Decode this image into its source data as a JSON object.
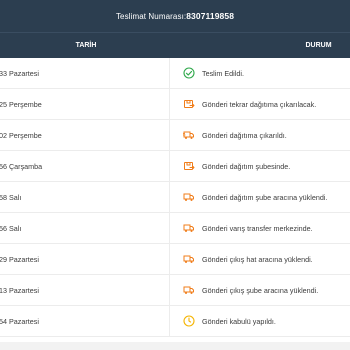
{
  "tracking": {
    "label": "Teslimat Numarası:",
    "number": "8307119858"
  },
  "table": {
    "headers": {
      "date": "TARİH",
      "status": "DURUM"
    },
    "rows": [
      {
        "date": ":33 Pazartesi",
        "status": "Teslim Edildi.",
        "icon": "check-circle-icon",
        "color": "#2ea84a"
      },
      {
        "date": ":25 Perşembe",
        "status": "Gönderi tekrar dağıtıma çıkarılacak.",
        "icon": "box-return-icon",
        "color": "#f07d1a"
      },
      {
        "date": ":02 Perşembe",
        "status": "Gönderi dağıtıma çıkarıldı.",
        "icon": "delivery-truck-icon",
        "color": "#f07d1a"
      },
      {
        "date": ":56 Çarşamba",
        "status": "Gönderi dağıtım şubesinde.",
        "icon": "box-arrow-icon",
        "color": "#f07d1a"
      },
      {
        "date": ":58 Salı",
        "status": "Gönderi dağıtım şube aracına yüklendi.",
        "icon": "truck-icon",
        "color": "#f07d1a"
      },
      {
        "date": ":56 Salı",
        "status": "Gönderi varış transfer merkezinde.",
        "icon": "truck-icon",
        "color": "#f07d1a"
      },
      {
        "date": ":29 Pazartesi",
        "status": "Gönderi çıkış hat aracına yüklendi.",
        "icon": "truck-icon",
        "color": "#f07d1a"
      },
      {
        "date": ":13 Pazartesi",
        "status": "Gönderi çıkış şube aracına yüklendi.",
        "icon": "truck-icon",
        "color": "#f07d1a"
      },
      {
        "date": ":54 Pazartesi",
        "status": "Gönderi kabulü yapıldı.",
        "icon": "clock-icon",
        "color": "#f5b400"
      }
    ]
  },
  "colors": {
    "header_bg": "#2c3e50",
    "success": "#2ea84a",
    "warning": "#f07d1a",
    "pending": "#f5b400"
  }
}
